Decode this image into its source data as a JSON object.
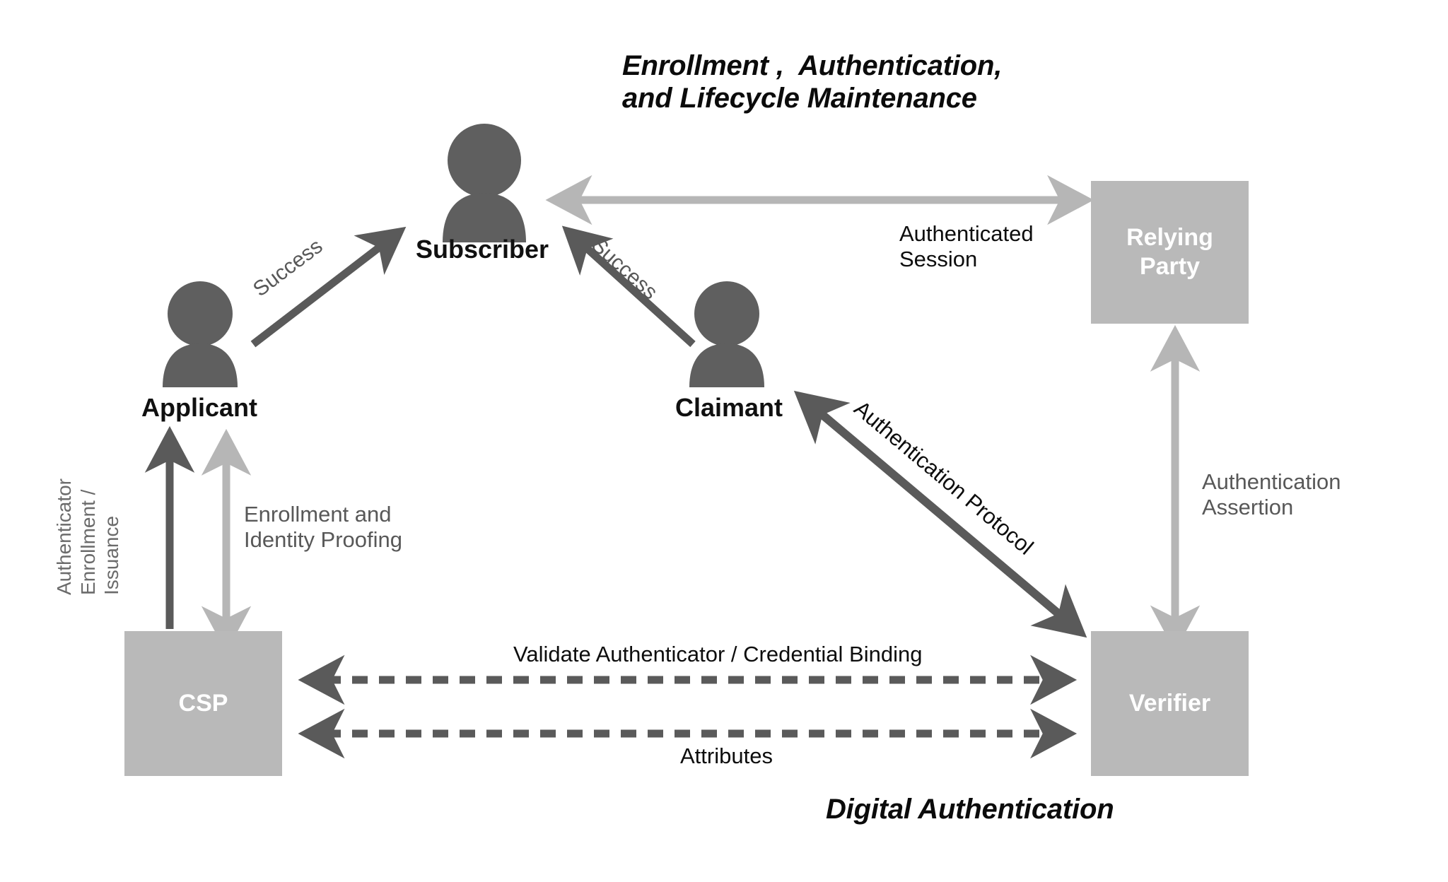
{
  "diagram": {
    "title": "Enrollment ,  Authentication,\nand Lifecycle Maintenance",
    "title_line1": "Enrollment ,  Authentication,",
    "title_line2": "and Lifecycle Maintenance",
    "caption": "Digital Authentication",
    "background": "#ffffff",
    "colors": {
      "actor_icon": "#5f5f5f",
      "box_fill": "#b9b9b9",
      "box_text": "#ffffff",
      "arrow_dark": "#5a5a5a",
      "arrow_light": "#b6b6b6",
      "text_dark": "#0d0d0d",
      "text_gray": "#585858",
      "text_gray_light": "#6b6b6b"
    }
  },
  "actors": [
    {
      "id": "subscriber",
      "label": "Subscriber",
      "icon": "person-icon"
    },
    {
      "id": "applicant",
      "label": "Applicant",
      "icon": "person-icon"
    },
    {
      "id": "claimant",
      "label": "Claimant",
      "icon": "person-icon"
    }
  ],
  "boxes": [
    {
      "id": "relying-party",
      "label": "Relying\nParty",
      "line1": "Relying",
      "line2": "Party"
    },
    {
      "id": "csp",
      "label": "CSP",
      "line1": "CSP",
      "line2": ""
    },
    {
      "id": "verifier",
      "label": "Verifier",
      "line1": "Verifier",
      "line2": ""
    }
  ],
  "edges": [
    {
      "id": "applicant-to-subscriber",
      "label": "Success",
      "style": "solid",
      "color": "#5a5a5a",
      "heads": "single",
      "from": "applicant",
      "to": "subscriber"
    },
    {
      "id": "claimant-to-subscriber",
      "label": "Success",
      "style": "solid",
      "color": "#5a5a5a",
      "heads": "single",
      "from": "claimant",
      "to": "subscriber"
    },
    {
      "id": "subscriber-relying-party",
      "label": "Authenticated\nSession",
      "label_line1": "Authenticated",
      "label_line2": "Session",
      "style": "solid",
      "color": "#b6b6b6",
      "heads": "double",
      "from": "subscriber",
      "to": "relying-party"
    },
    {
      "id": "csp-to-applicant-authenticator",
      "label": "Authenticator\nEnrollment /\nIssuance",
      "label_line1": "Authenticator",
      "label_line2": "Enrollment /",
      "label_line3": "Issuance",
      "style": "solid",
      "color": "#5a5a5a",
      "heads": "single",
      "from": "csp",
      "to": "applicant"
    },
    {
      "id": "applicant-csp-enrollment",
      "label": "Enrollment and\nIdentity Proofing",
      "label_line1": "Enrollment and",
      "label_line2": "Identity Proofing",
      "style": "solid",
      "color": "#b6b6b6",
      "heads": "double",
      "from": "applicant",
      "to": "csp"
    },
    {
      "id": "claimant-verifier-protocol",
      "label": "Authentication Protocol",
      "style": "solid",
      "color": "#5a5a5a",
      "heads": "double",
      "from": "claimant",
      "to": "verifier"
    },
    {
      "id": "verifier-relying-party-assertion",
      "label": "Authentication\nAssertion",
      "label_line1": "Authentication",
      "label_line2": "Assertion",
      "style": "solid",
      "color": "#b6b6b6",
      "heads": "double",
      "from": "verifier",
      "to": "relying-party"
    },
    {
      "id": "csp-verifier-validate",
      "label": "Validate Authenticator / Credential Binding",
      "style": "dashed",
      "color": "#5a5a5a",
      "heads": "double",
      "from": "csp",
      "to": "verifier"
    },
    {
      "id": "csp-verifier-attributes",
      "label": "Attributes",
      "style": "dashed",
      "color": "#5a5a5a",
      "heads": "double",
      "from": "csp",
      "to": "verifier"
    }
  ]
}
